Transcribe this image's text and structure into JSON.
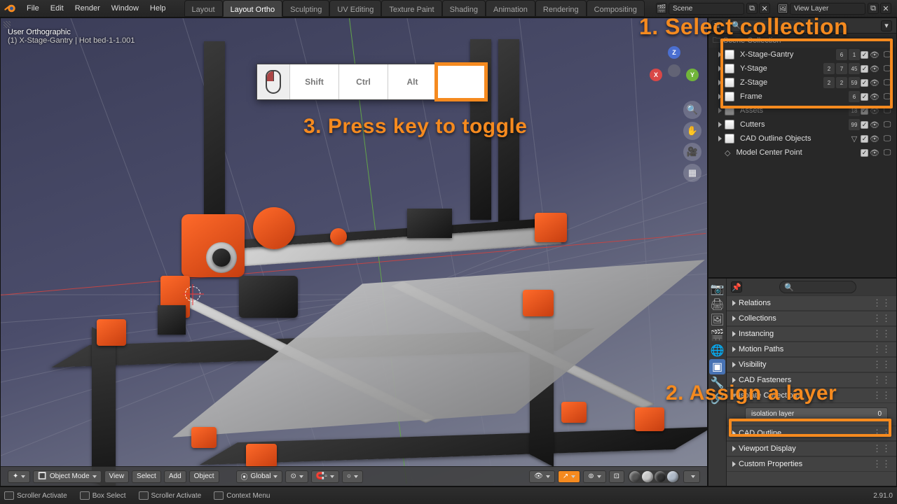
{
  "menus": [
    "File",
    "Edit",
    "Render",
    "Window",
    "Help"
  ],
  "tabs": [
    "Layout",
    "Layout Ortho",
    "Sculpting",
    "UV Editing",
    "Texture Paint",
    "Shading",
    "Animation",
    "Rendering",
    "Compositing"
  ],
  "active_tab": 1,
  "scene_label": "Scene",
  "viewlayer_label": "View Layer",
  "overlay_title": "User Orthographic",
  "overlay_sub": "(1) X-Stage-Gantry | Hot bed-1-1.001",
  "key_widget": {
    "mods": [
      "Shift",
      "Ctrl",
      "Alt",
      ""
    ],
    "highlight": 3
  },
  "annotations": {
    "a1": "1. Select collection",
    "a2": "2. Assign a layer",
    "a3": "3. Press key to toggle"
  },
  "outliner": {
    "root": "Scene Collection",
    "items": [
      {
        "name": "X-Stage-Gantry",
        "counts": [
          "6",
          "1"
        ]
      },
      {
        "name": "Y-Stage",
        "counts": [
          "2",
          "7",
          "45"
        ]
      },
      {
        "name": "Z-Stage",
        "counts": [
          "2",
          "2",
          "59"
        ]
      },
      {
        "name": "Frame",
        "counts": [
          "6"
        ]
      },
      {
        "name": "Assets",
        "counts": [
          "18"
        ],
        "dim": true
      },
      {
        "name": "Cutters",
        "counts": [
          "99"
        ]
      },
      {
        "name": "CAD Outline Objects",
        "counts": [],
        "extra": true
      },
      {
        "name": "Model Center Point",
        "leaf": true
      }
    ]
  },
  "props_panels": [
    "Relations",
    "Collections",
    "Instancing",
    "Motion Paths",
    "Visibility",
    "CAD Fasteners",
    "Isolate Collections"
  ],
  "iso_label": "isolation layer",
  "iso_value": "0",
  "props_panels_after": [
    "CAD Outline",
    "Viewport Display",
    "Custom Properties"
  ],
  "viewport_footer": {
    "mode": "Object Mode",
    "menus": [
      "View",
      "Select",
      "Add",
      "Object"
    ],
    "orient": "Global"
  },
  "status": {
    "left": "Scroller Activate",
    "boxsel": "Box Select",
    "scroll2": "Scroller Activate",
    "ctx": "Context Menu",
    "version": "2.91.0"
  },
  "axes": {
    "x": "X",
    "y": "Y",
    "z": "Z"
  }
}
